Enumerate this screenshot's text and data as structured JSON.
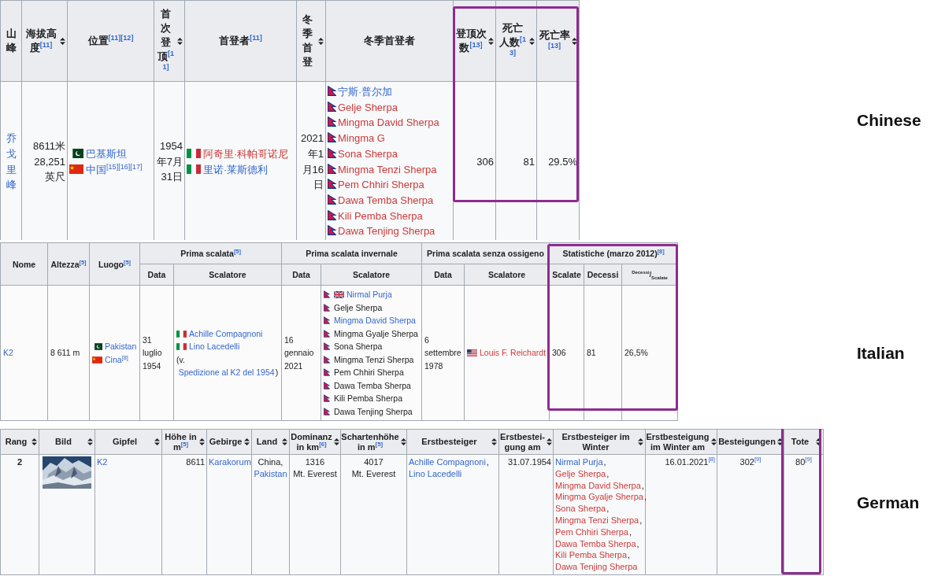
{
  "tables": [
    {
      "label": "Chinese",
      "highlight": true,
      "header_rows": [
        [
          {
            "text": "山峰",
            "sortable": false
          },
          {
            "text": "海拔高度$^{[11]}$",
            "sortable": true
          },
          {
            "text": "位置$^{[11][12]}$",
            "sortable": false
          },
          {
            "text": "首次登顶$^{[11]}$",
            "sortable": true
          },
          {
            "text": "首登者$^{[11]}$",
            "sortable": false
          },
          {
            "text": "冬季首登",
            "sortable": true
          },
          {
            "text": "冬季首登者",
            "sortable": false
          },
          {
            "text": "登顶次数$^{[13]}$",
            "sortable": true
          },
          {
            "text": "死亡人数$^{[13]}$",
            "sortable": true
          },
          {
            "text": "死亡率$^{[13]}$",
            "sortable": true
          }
        ]
      ],
      "cells": [
        {
          "lines": [
            [
              {
                "text": "乔戈里峰",
                "kind": "link"
              }
            ]
          ]
        },
        {
          "lines": [
            [
              {
                "text": "8611米",
                "kind": "plain"
              }
            ],
            [
              {
                "text": "28,251",
                "kind": "plain"
              }
            ],
            [
              {
                "text": "英尺",
                "kind": "plain"
              }
            ]
          ]
        },
        {
          "lines": [
            [
              {
                "text": "巴基斯坦",
                "kind": "link",
                "flags": [
                  {
                    "kind": "pk"
                  }
                ]
              }
            ],
            [
              {
                "text": "中国$^{[15][16][17]}$",
                "kind": "link",
                "flags": [
                  {
                    "kind": "cn"
                  }
                ]
              }
            ]
          ]
        },
        {
          "lines": [
            [
              {
                "text": "1954年7月31日",
                "kind": "plain"
              }
            ]
          ]
        },
        {
          "lines": [
            [
              {
                "text": "阿奇里·科帕哥诺尼",
                "kind": "redlink",
                "flags": [
                  {
                    "kind": "it"
                  }
                ]
              }
            ],
            [
              {
                "text": "里诺·莱斯德利",
                "kind": "link",
                "flags": [
                  {
                    "kind": "it"
                  }
                ]
              }
            ]
          ]
        },
        {
          "lines": [
            [
              {
                "text": "2021年1月16日",
                "kind": "plain"
              }
            ]
          ]
        },
        {
          "lines": [
            [
              {
                "text": "宁斯·普尔加",
                "kind": "link",
                "flags": [
                  {
                    "kind": "np"
                  }
                ]
              }
            ],
            [
              {
                "text": "Gelje Sherpa",
                "kind": "redlink",
                "flags": [
                  {
                    "kind": "np"
                  }
                ]
              }
            ],
            [
              {
                "text": "Mingma David Sherpa",
                "kind": "redlink",
                "flags": [
                  {
                    "kind": "np"
                  }
                ]
              }
            ],
            [
              {
                "text": "Mingma G",
                "kind": "redlink",
                "flags": [
                  {
                    "kind": "np"
                  }
                ]
              }
            ],
            [
              {
                "text": "Sona Sherpa",
                "kind": "redlink",
                "flags": [
                  {
                    "kind": "np"
                  }
                ]
              }
            ],
            [
              {
                "text": "Mingma Tenzi Sherpa",
                "kind": "redlink",
                "flags": [
                  {
                    "kind": "np"
                  }
                ]
              }
            ],
            [
              {
                "text": "Pem Chhiri Sherpa",
                "kind": "redlink",
                "flags": [
                  {
                    "kind": "np"
                  }
                ]
              }
            ],
            [
              {
                "text": "Dawa Temba Sherpa",
                "kind": "redlink",
                "flags": [
                  {
                    "kind": "np"
                  }
                ]
              }
            ],
            [
              {
                "text": "Kili Pemba Sherpa",
                "kind": "redlink",
                "flags": [
                  {
                    "kind": "np"
                  }
                ]
              }
            ],
            [
              {
                "text": "Dawa Tenjing Sherpa",
                "kind": "redlink",
                "flags": [
                  {
                    "kind": "np"
                  }
                ]
              }
            ]
          ]
        },
        {
          "lines": [
            [
              {
                "text": "306",
                "kind": "plain"
              }
            ]
          ]
        },
        {
          "lines": [
            [
              {
                "text": "81",
                "kind": "plain"
              }
            ]
          ]
        },
        {
          "lines": [
            [
              {
                "text": "29.5%",
                "kind": "plain"
              }
            ]
          ]
        }
      ]
    },
    {
      "label": "Italian",
      "highlight": true,
      "header_rows": [
        [
          {
            "text": "Nome",
            "rowspan": 2
          },
          {
            "text": "Altezza$^{[5]}$",
            "rowspan": 2
          },
          {
            "text": "Luogo$^{[5]}$",
            "rowspan": 2
          },
          {
            "text": "Prima scalata$^{[5]}$",
            "colspan": 2
          },
          {
            "text": "Prima scalata invernale",
            "colspan": 2
          },
          {
            "text": "Prima scalata senza ossigeno",
            "colspan": 2
          },
          {
            "text": "Statistiche (marzo 2012)$^{[8]}$",
            "colspan": 3
          }
        ],
        [
          {
            "text": "Data"
          },
          {
            "text": "Scalatore"
          },
          {
            "text": "Data"
          },
          {
            "text": "Scalatore"
          },
          {
            "text": "Data"
          },
          {
            "text": "Scalatore"
          },
          {
            "text": "Scalate"
          },
          {
            "text": "Decessi"
          },
          {
            "text": "$^{Decessi}$/$_{Scalate}$",
            "kind": "fraction"
          }
        ]
      ],
      "cells": [
        {
          "lines": [
            [
              {
                "text": "K2",
                "kind": "link"
              }
            ]
          ]
        },
        {
          "lines": [
            [
              {
                "text": "8 611 m",
                "kind": "plain"
              }
            ]
          ]
        },
        {
          "lines": [
            [
              {
                "text": "Pakistan",
                "kind": "link",
                "flags": [
                  {
                    "kind": "pk"
                  }
                ]
              }
            ],
            [
              {
                "text": "Cina$^{[8]}$",
                "kind": "link",
                "flags": [
                  {
                    "kind": "cn"
                  }
                ]
              }
            ]
          ]
        },
        {
          "lines": [
            [
              {
                "text": "31 luglio 1954",
                "kind": "plain"
              }
            ]
          ]
        },
        {
          "lines": [
            [
              {
                "text": "Achille Compagnoni",
                "kind": "link",
                "flags": [
                  {
                    "kind": "it"
                  }
                ]
              }
            ],
            [
              {
                "text": "Lino Lacedelli",
                "kind": "link",
                "flags": [
                  {
                    "kind": "it"
                  }
                ]
              }
            ],
            [
              {
                "text": "(v.",
                "kind": "plain"
              },
              {
                "text": "Spedizione al K2 del 1954",
                "kind": "link",
                "suffix": ")"
              }
            ]
          ]
        },
        {
          "lines": [
            [
              {
                "text": "16 gennaio 2021",
                "kind": "plain"
              }
            ]
          ]
        },
        {
          "lines": [
            [
              {
                "text": "Nirmal Purja",
                "kind": "link",
                "flags": [
                  {
                    "kind": "np"
                  },
                  {
                    "kind": "gb"
                  }
                ]
              }
            ],
            [
              {
                "text": "Gelje Sherpa",
                "kind": "plain",
                "flags": [
                  {
                    "kind": "np"
                  }
                ]
              }
            ],
            [
              {
                "text": "Mingma David Sherpa",
                "kind": "link",
                "flags": [
                  {
                    "kind": "np"
                  }
                ]
              }
            ],
            [
              {
                "text": "Mingma Gyalje Sherpa",
                "kind": "plain",
                "flags": [
                  {
                    "kind": "np"
                  }
                ]
              }
            ],
            [
              {
                "text": "Sona Sherpa",
                "kind": "plain",
                "flags": [
                  {
                    "kind": "np"
                  }
                ]
              }
            ],
            [
              {
                "text": "Mingma Tenzi Sherpa",
                "kind": "plain",
                "flags": [
                  {
                    "kind": "np"
                  }
                ]
              }
            ],
            [
              {
                "text": "Pem Chhiri Sherpa",
                "kind": "plain",
                "flags": [
                  {
                    "kind": "np"
                  }
                ]
              }
            ],
            [
              {
                "text": "Dawa Temba Sherpa",
                "kind": "plain",
                "flags": [
                  {
                    "kind": "np"
                  }
                ]
              }
            ],
            [
              {
                "text": "Kili Pemba Sherpa",
                "kind": "plain",
                "flags": [
                  {
                    "kind": "np"
                  }
                ]
              }
            ],
            [
              {
                "text": "Dawa Tenjing Sherpa",
                "kind": "plain",
                "flags": [
                  {
                    "kind": "np"
                  }
                ]
              }
            ]
          ]
        },
        {
          "lines": [
            [
              {
                "text": "6 settembre 1978",
                "kind": "plain"
              }
            ]
          ]
        },
        {
          "lines": [
            [
              {
                "text": "Louis F. Reichardt",
                "kind": "redlink",
                "flags": [
                  {
                    "kind": "us"
                  }
                ]
              }
            ]
          ]
        },
        {
          "lines": [
            [
              {
                "text": "306",
                "kind": "plain"
              }
            ]
          ]
        },
        {
          "lines": [
            [
              {
                "text": "81",
                "kind": "plain"
              }
            ]
          ]
        },
        {
          "lines": [
            [
              {
                "text": "26,5%",
                "kind": "plain"
              }
            ]
          ]
        }
      ]
    },
    {
      "label": "German",
      "highlight": true,
      "header_rows": [
        [
          {
            "text": "Rang",
            "sortable": true
          },
          {
            "text": "Bild",
            "sortable": true
          },
          {
            "text": "Gipfel",
            "sortable": true
          },
          {
            "text": "Höhe in m$^{[5]}$",
            "sortable": true
          },
          {
            "text": "Gebirge",
            "sortable": true
          },
          {
            "text": "Land",
            "sortable": true
          },
          {
            "text": "Dominanz in km$^{[6]}$",
            "sortable": true
          },
          {
            "text": "Schartenhöhe in m$^{[5]}$",
            "sortable": true
          },
          {
            "text": "Erstbesteiger",
            "sortable": true
          },
          {
            "text": "Erstbestei-gung am",
            "sortable": true
          },
          {
            "text": "Erstbesteiger im Winter",
            "sortable": true
          },
          {
            "text": "Erstbesteigung im Winter am",
            "sortable": true
          },
          {
            "text": "Besteigungen",
            "sortable": true
          },
          {
            "text": "Tote",
            "sortable": true
          }
        ]
      ],
      "cells": [
        {
          "lines": [
            [
              {
                "text": "2",
                "kind": "plain"
              }
            ]
          ]
        },
        {
          "kind": "picture"
        },
        {
          "lines": [
            [
              {
                "text": "K2",
                "kind": "link"
              }
            ]
          ]
        },
        {
          "lines": [
            [
              {
                "text": "8611",
                "kind": "plain"
              }
            ]
          ]
        },
        {
          "lines": [
            [
              {
                "text": "Karakorum",
                "kind": "link"
              }
            ]
          ]
        },
        {
          "lines": [
            [
              {
                "text": "China,",
                "kind": "plain"
              }
            ],
            [
              {
                "text": "Pakistan",
                "kind": "link"
              }
            ]
          ]
        },
        {
          "lines": [
            [
              {
                "text": "1316",
                "kind": "plain"
              }
            ],
            [
              {
                "text": "Mt. Everest",
                "kind": "plain"
              }
            ]
          ]
        },
        {
          "lines": [
            [
              {
                "text": "4017",
                "kind": "plain"
              }
            ],
            [
              {
                "text": "Mt. Everest",
                "kind": "plain"
              }
            ]
          ]
        },
        {
          "lines": [
            [
              {
                "text": "Achille Compagnoni",
                "kind": "link",
                "suffix": ","
              }
            ],
            [
              {
                "text": "Lino Lacedelli",
                "kind": "link"
              }
            ]
          ]
        },
        {
          "lines": [
            [
              {
                "text": "31.07.1954",
                "kind": "plain"
              }
            ]
          ]
        },
        {
          "lines": [
            [
              {
                "text": "Nirmal Purja",
                "kind": "link",
                "suffix": ","
              }
            ],
            [
              {
                "text": "Gelje Sherpa",
                "kind": "redlink",
                "suffix": ","
              }
            ],
            [
              {
                "text": "Mingma David Sherpa",
                "kind": "redlink",
                "suffix": ","
              }
            ],
            [
              {
                "text": "Mingma Gyalje Sherpa",
                "kind": "redlink",
                "suffix": ","
              }
            ],
            [
              {
                "text": "Sona Sherpa",
                "kind": "redlink",
                "suffix": ","
              }
            ],
            [
              {
                "text": "Mingma Tenzi Sherpa",
                "kind": "redlink",
                "suffix": ","
              }
            ],
            [
              {
                "text": "Pem Chhiri Sherpa",
                "kind": "redlink",
                "suffix": ","
              }
            ],
            [
              {
                "text": "Dawa Temba Sherpa",
                "kind": "redlink",
                "suffix": ","
              }
            ],
            [
              {
                "text": "Kili Pemba Sherpa",
                "kind": "redlink",
                "suffix": ","
              }
            ],
            [
              {
                "text": "Dawa Tenjing Sherpa",
                "kind": "redlink"
              }
            ]
          ]
        },
        {
          "lines": [
            [
              {
                "text": "16.01.2021$^{[8]}$",
                "kind": "plain"
              }
            ]
          ]
        },
        {
          "lines": [
            [
              {
                "text": "302$^{[9]}$",
                "kind": "plain"
              }
            ]
          ]
        },
        {
          "lines": [
            [
              {
                "text": "80$^{[9]}$",
                "kind": "plain"
              }
            ]
          ]
        }
      ]
    }
  ]
}
